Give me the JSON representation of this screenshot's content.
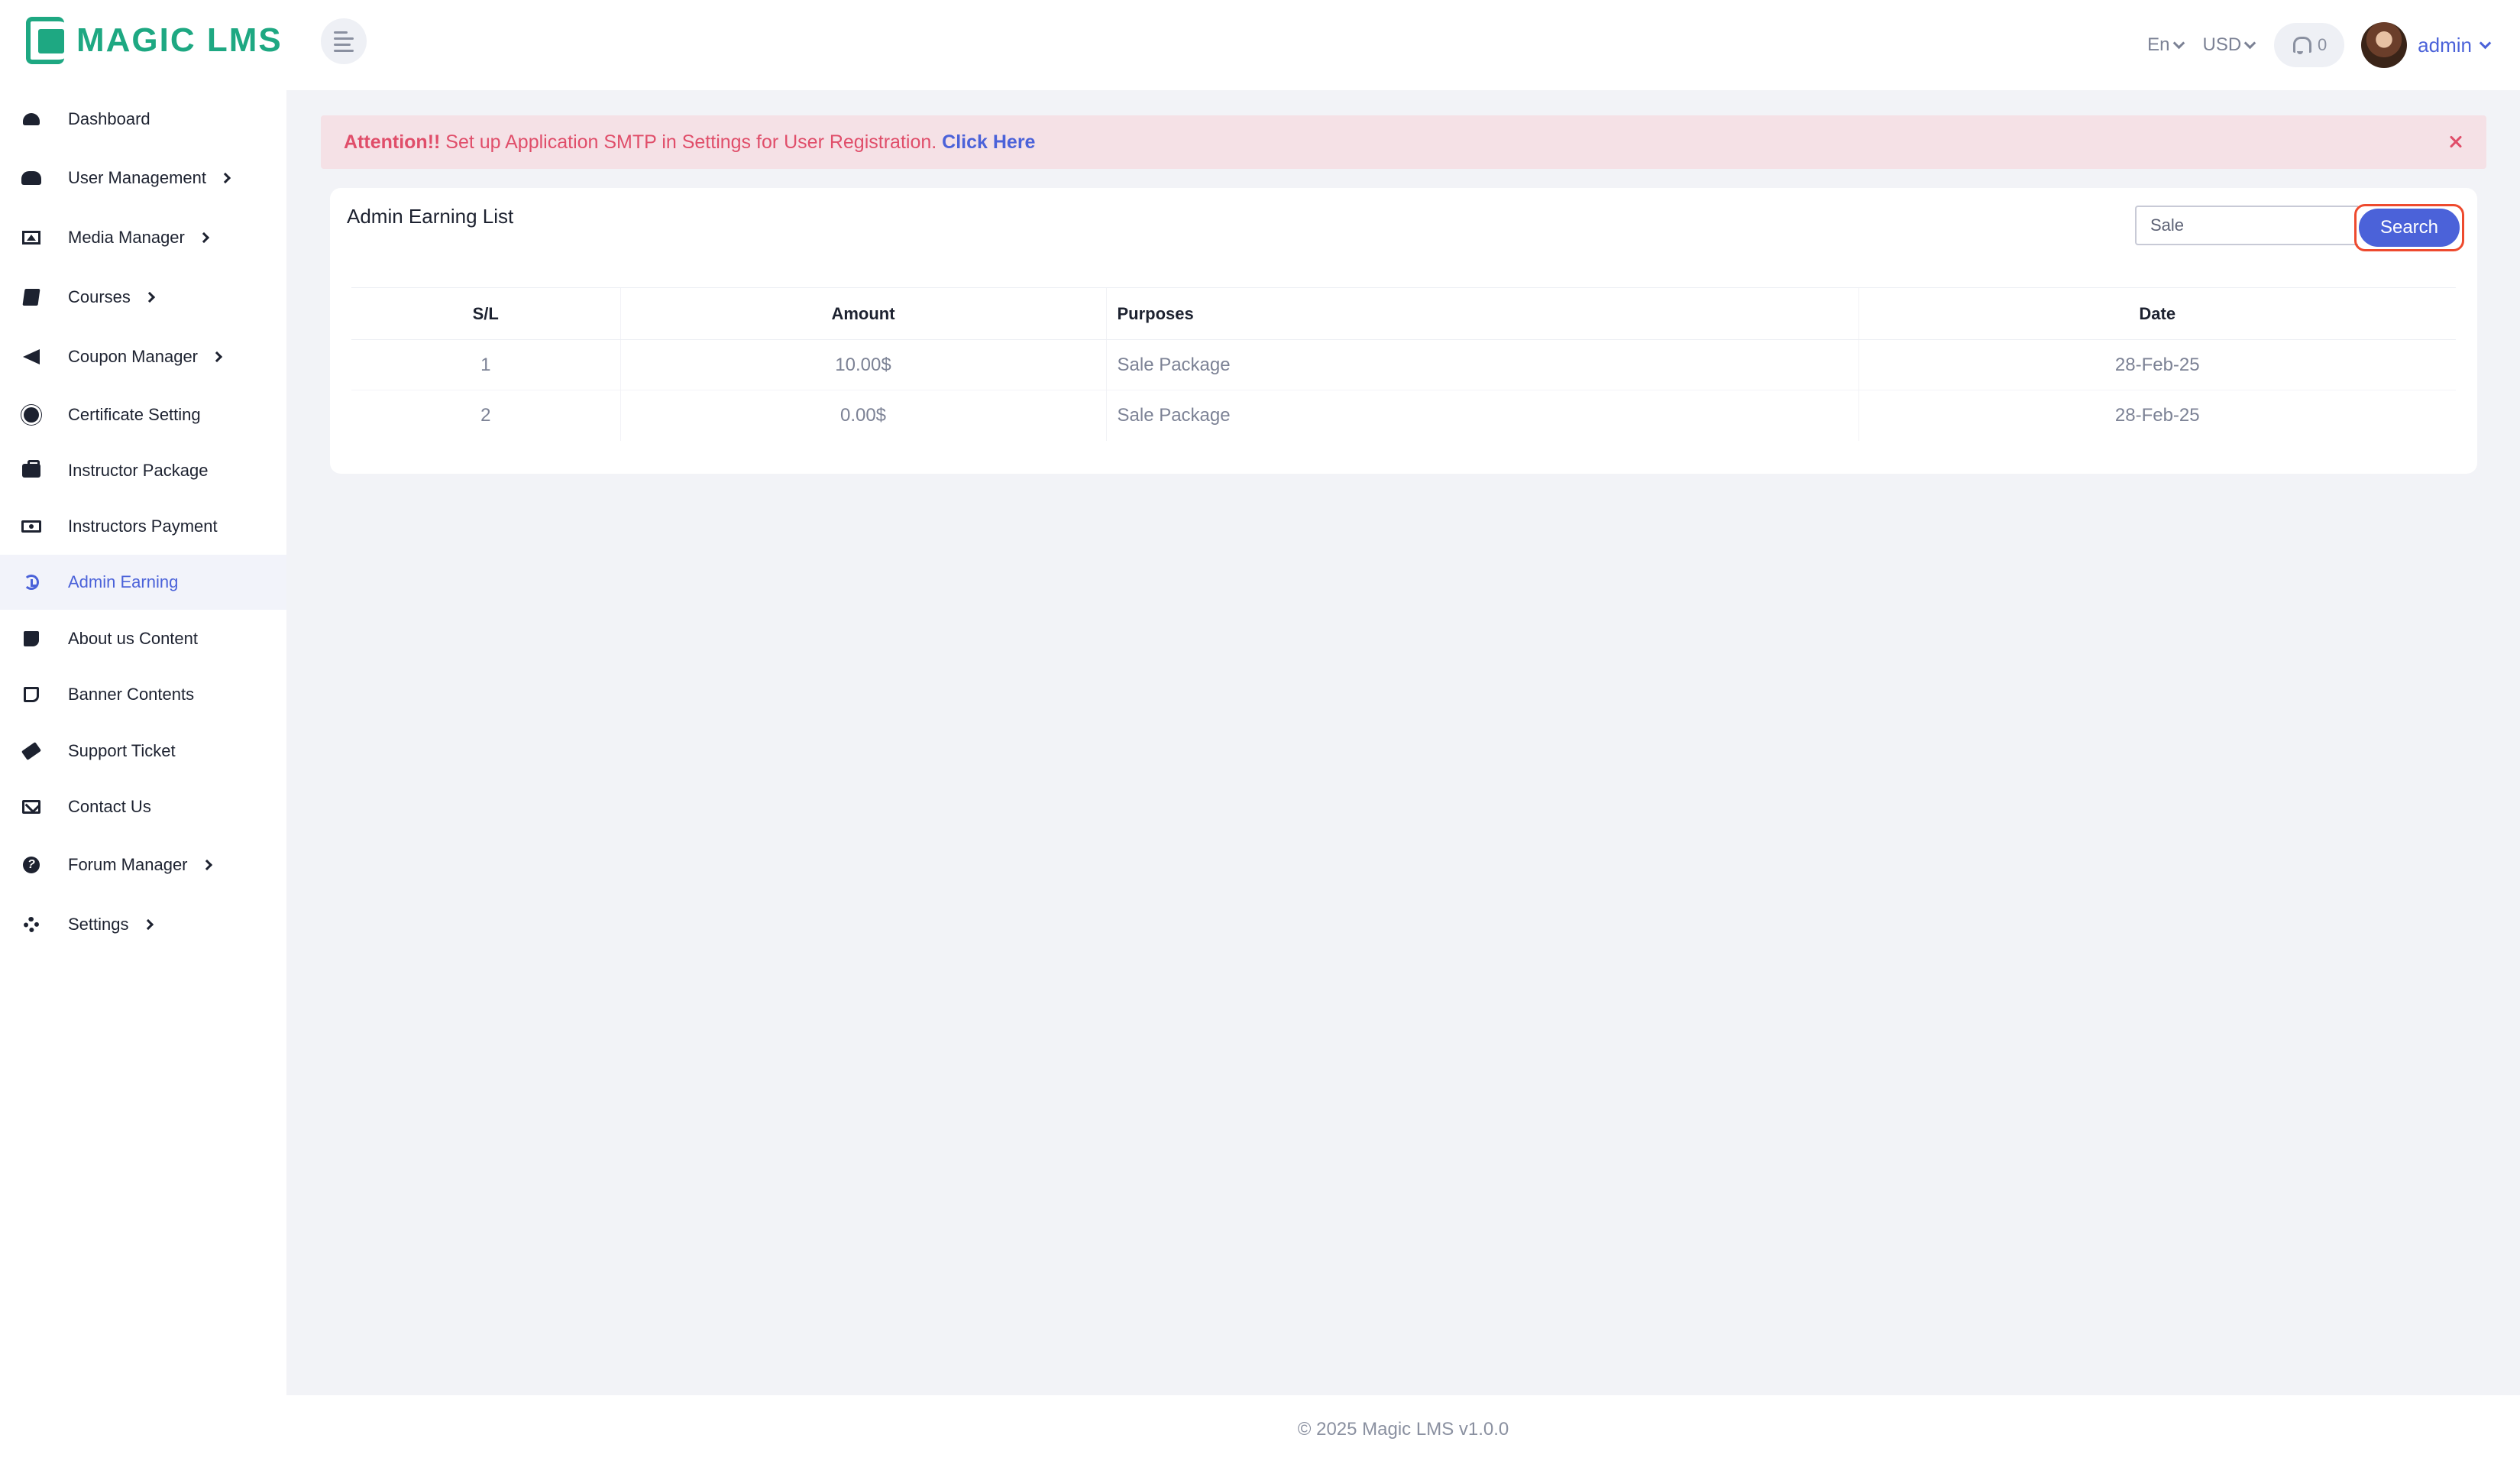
{
  "brand": {
    "name": "MAGIC LMS"
  },
  "header": {
    "language": "En",
    "currency": "USD",
    "notification_count": "0",
    "user_name": "admin"
  },
  "sidebar": {
    "items": [
      {
        "label": "Dashboard",
        "icon": "dashboard-icon",
        "has_submenu": false,
        "active": false
      },
      {
        "label": "User Management",
        "icon": "users-icon",
        "has_submenu": true,
        "active": false
      },
      {
        "label": "Media Manager",
        "icon": "image-icon",
        "has_submenu": true,
        "active": false
      },
      {
        "label": "Courses",
        "icon": "book-icon",
        "has_submenu": true,
        "active": false
      },
      {
        "label": "Coupon Manager",
        "icon": "bullhorn-icon",
        "has_submenu": true,
        "active": false
      },
      {
        "label": "Certificate Setting",
        "icon": "certificate-icon",
        "has_submenu": false,
        "active": false
      },
      {
        "label": "Instructor Package",
        "icon": "briefcase-icon",
        "has_submenu": false,
        "active": false
      },
      {
        "label": "Instructors Payment",
        "icon": "money-icon",
        "has_submenu": false,
        "active": false
      },
      {
        "label": "Admin Earning",
        "icon": "history-icon",
        "has_submenu": false,
        "active": true
      },
      {
        "label": "About us Content",
        "icon": "sticky-note-icon",
        "has_submenu": false,
        "active": false
      },
      {
        "label": "Banner Contents",
        "icon": "note-icon",
        "has_submenu": false,
        "active": false
      },
      {
        "label": "Support Ticket",
        "icon": "ticket-icon",
        "has_submenu": false,
        "active": false
      },
      {
        "label": "Contact Us",
        "icon": "envelope-icon",
        "has_submenu": false,
        "active": false
      },
      {
        "label": "Forum Manager",
        "icon": "question-icon",
        "has_submenu": true,
        "active": false
      },
      {
        "label": "Settings",
        "icon": "gear-icon",
        "has_submenu": true,
        "active": false
      }
    ]
  },
  "alert": {
    "strong": "Attention!!",
    "message": " Set up Application SMTP in Settings for User Registration. ",
    "link": "Click Here"
  },
  "card": {
    "title": "Admin Earning List",
    "search_value": "Sale",
    "search_button": "Search"
  },
  "table": {
    "headers": {
      "sl": "S/L",
      "amount": "Amount",
      "purposes": "Purposes",
      "date": "Date"
    },
    "rows": [
      {
        "sl": "1",
        "amount": "10.00$",
        "purposes": "Sale Package",
        "date": "28-Feb-25"
      },
      {
        "sl": "2",
        "amount": "0.00$",
        "purposes": "Sale Package",
        "date": "28-Feb-25"
      }
    ]
  },
  "footer": {
    "text": "© 2025 Magic LMS v1.0.0"
  },
  "colors": {
    "brand": "#1ea882",
    "accent": "#4b62d9",
    "alert_text": "#e04e6a",
    "alert_bg": "#f5e1e6",
    "highlight": "#ee4a2e"
  }
}
